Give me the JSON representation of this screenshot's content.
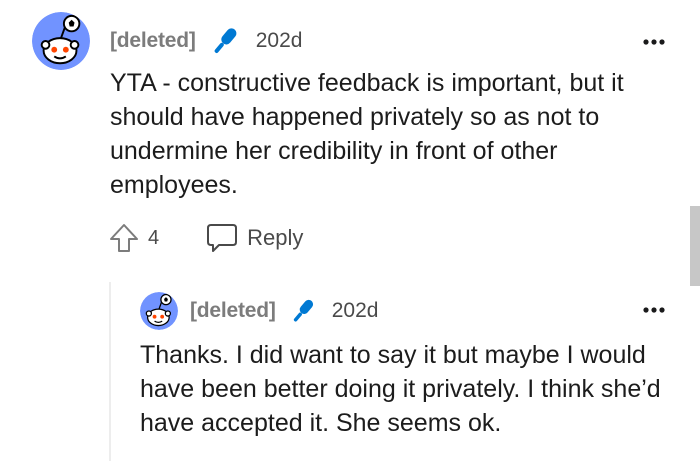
{
  "comment": {
    "username": "[deleted]",
    "age": "202d",
    "text": "YTA - constructive feedback is important, but it should have happened privately so as not to undermine her credibility in front of other employees.",
    "upvotes": "4",
    "reply_label": "Reply",
    "icons": {
      "avatar": "snoo-avatar",
      "flair": "microphone-icon",
      "more": "more-options-icon",
      "upvote": "upvote-arrow-icon",
      "reply": "speech-bubble-icon"
    }
  },
  "reply": {
    "username": "[deleted]",
    "age": "202d",
    "text": "Thanks. I did want to say it but maybe I would have been better doing it privately. I think she’d have accepted it. She seems ok."
  },
  "colors": {
    "avatar_bg": "#7193ff",
    "mic_blue": "#0079d3",
    "meta_gray": "#7c7c7c",
    "text": "#1c1c1c"
  }
}
